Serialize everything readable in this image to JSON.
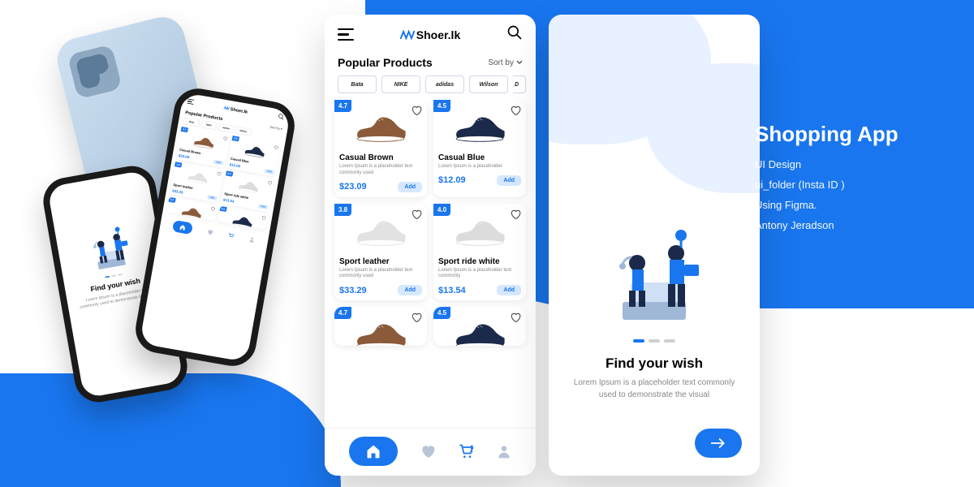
{
  "logo_text": "Shoer.lk",
  "section_title": "Popular Products",
  "sort_label": "Sort by",
  "brands": [
    "Bata",
    "NIKE",
    "adidas",
    "Wilson",
    "D"
  ],
  "products": [
    {
      "rating": "4.7",
      "title": "Casual Brown",
      "desc": "Lorem Ipsum is a placeholder text commonly used",
      "price": "$23.09",
      "add": "Add",
      "color": "#8a5a3a"
    },
    {
      "rating": "4.5",
      "title": "Casual Blue",
      "desc": "Lorem Ipsum is a placeholder",
      "price": "$12.09",
      "add": "Add",
      "color": "#1b2a4a"
    },
    {
      "rating": "3.8",
      "title": "Sport leather",
      "desc": "Lorem Ipsum is a placeholder text commonly used",
      "price": "$33.29",
      "add": "Add",
      "color": "#e2e2e2"
    },
    {
      "rating": "4.0",
      "title": "Sport ride white",
      "desc": "Lorem Ipsum is a placeholder text commonly",
      "price": "$13.54",
      "add": "Add",
      "color": "#dcdcdc"
    },
    {
      "rating": "4.7",
      "title": "",
      "desc": "",
      "price": "",
      "add": "",
      "color": "#8a5a3a"
    },
    {
      "rating": "4.5",
      "title": "",
      "desc": "",
      "price": "",
      "add": "",
      "color": "#1b2a4a"
    }
  ],
  "onboarding": {
    "title": "Find your wish",
    "desc": "Lorem Ipsum is a placeholder text commonly used  to demonstrate the visual"
  },
  "info": {
    "title": "Shopping App",
    "line1": "UI Design",
    "line2": "ui_folder (Insta ID )",
    "line3": "Using Figma.",
    "line4": "Antony Jeradson"
  }
}
